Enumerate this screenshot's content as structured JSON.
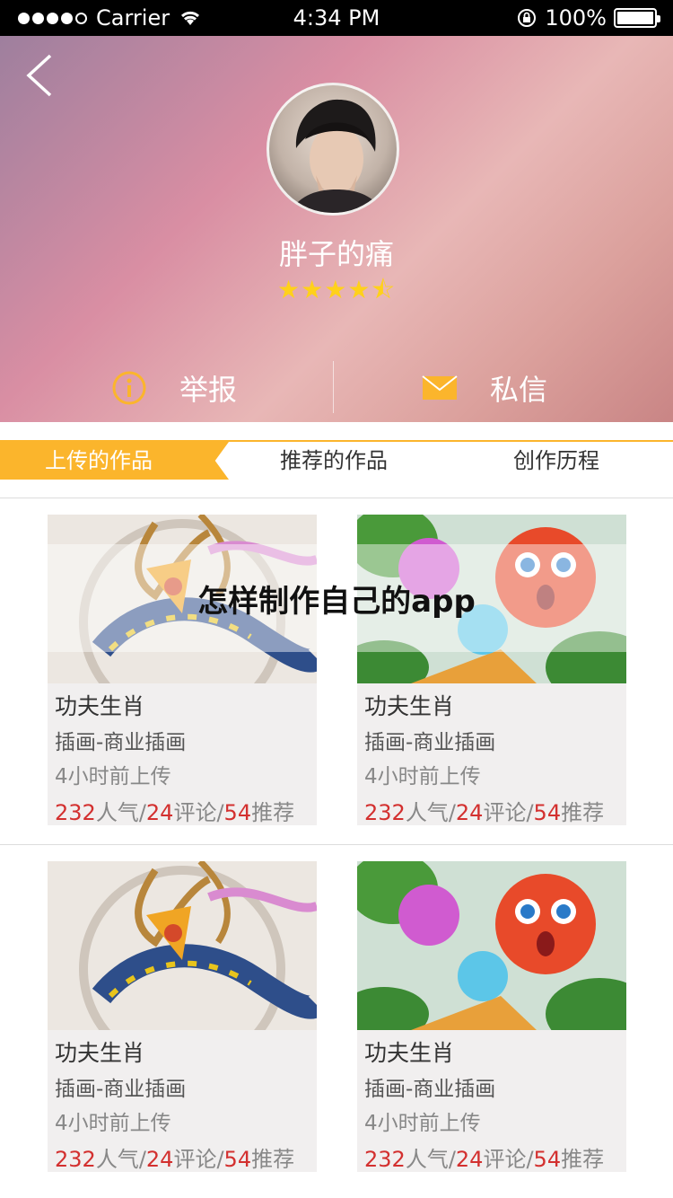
{
  "status_bar": {
    "carrier": "Carrier",
    "time": "4:34 PM",
    "battery": "100%"
  },
  "profile": {
    "name": "胖子的痛",
    "rating_stars": "★★★★⯪",
    "rating": 4.5
  },
  "actions": {
    "report_label": "举报",
    "message_label": "私信"
  },
  "tabs": [
    {
      "label": "上传的作品"
    },
    {
      "label": "推荐的作品"
    },
    {
      "label": "创作历程"
    }
  ],
  "works": [
    {
      "title": "功夫生肖",
      "category": "插画-商业插画",
      "time": "4小时前上传",
      "popularity": "232",
      "pop_label": "人气",
      "comments": "24",
      "comment_label": "评论",
      "recommends": "54",
      "rec_label": "推荐",
      "sep": "/"
    },
    {
      "title": "功夫生肖",
      "category": "插画-商业插画",
      "time": "4小时前上传",
      "popularity": "232",
      "pop_label": "人气",
      "comments": "24",
      "comment_label": "评论",
      "recommends": "54",
      "rec_label": "推荐",
      "sep": "/"
    },
    {
      "title": "功夫生肖",
      "category": "插画-商业插画",
      "time": "4小时前上传",
      "popularity": "232",
      "pop_label": "人气",
      "comments": "24",
      "comment_label": "评论",
      "recommends": "54",
      "rec_label": "推荐",
      "sep": "/"
    },
    {
      "title": "功夫生肖",
      "category": "插画-商业插画",
      "time": "4小时前上传",
      "popularity": "232",
      "pop_label": "人气",
      "comments": "24",
      "comment_label": "评论",
      "recommends": "54",
      "rec_label": "推荐",
      "sep": "/"
    }
  ],
  "overlay_text": "怎样制作自己的app",
  "icons": {
    "back": "chevron-left-icon",
    "report": "info-circle-icon",
    "message": "envelope-icon",
    "wifi": "wifi-icon",
    "lock": "rotation-lock-icon"
  },
  "colors": {
    "accent": "#fbb52c",
    "stat_number": "#d3302f",
    "star": "#ffd11a"
  }
}
